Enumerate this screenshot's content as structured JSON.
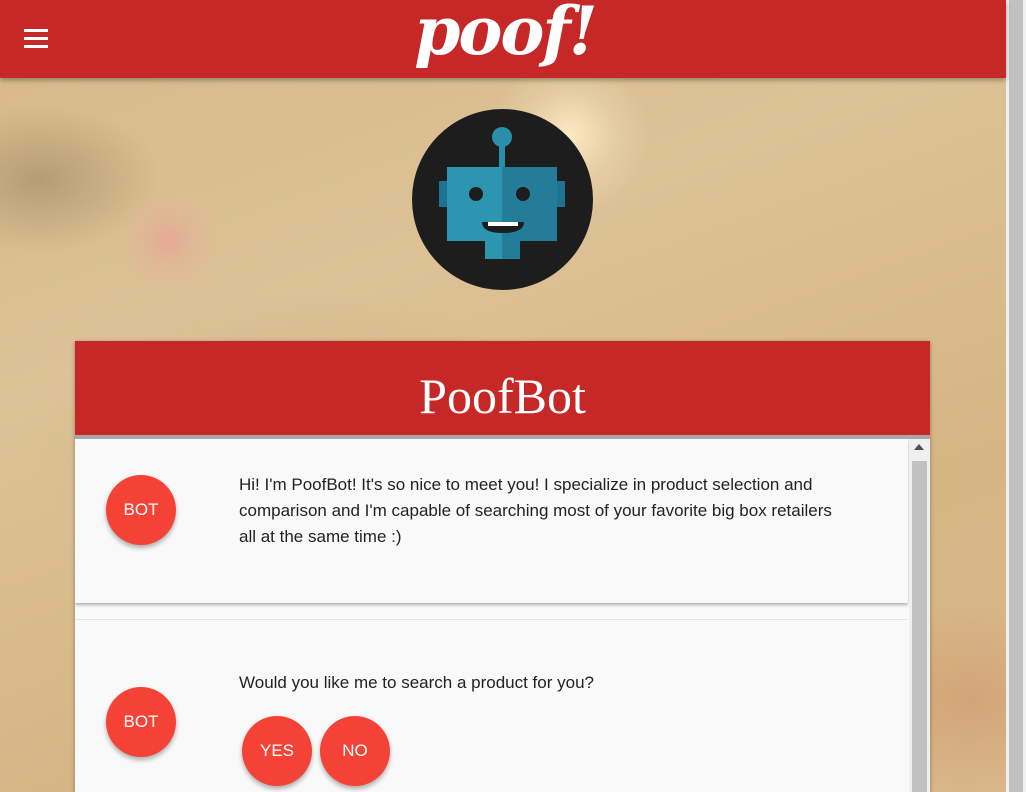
{
  "header": {
    "logo_text": "poof!",
    "menu_icon": "hamburger-menu-icon"
  },
  "avatar": {
    "icon": "robot-icon"
  },
  "chat": {
    "title": "PoofBot",
    "messages": [
      {
        "sender": "BOT",
        "text": "Hi! I'm PoofBot! It's so nice to meet you! I specialize in product selection and comparison and I'm capable of searching most of your favorite big box retailers all at the same time :)"
      },
      {
        "sender": "BOT",
        "text": "Would you like me to search a product for you?",
        "choices": [
          "YES",
          "NO"
        ]
      }
    ]
  },
  "colors": {
    "brand_red": "#c62828",
    "bot_bubble_red": "#f44336",
    "robot_teal": "#2a8fab"
  }
}
